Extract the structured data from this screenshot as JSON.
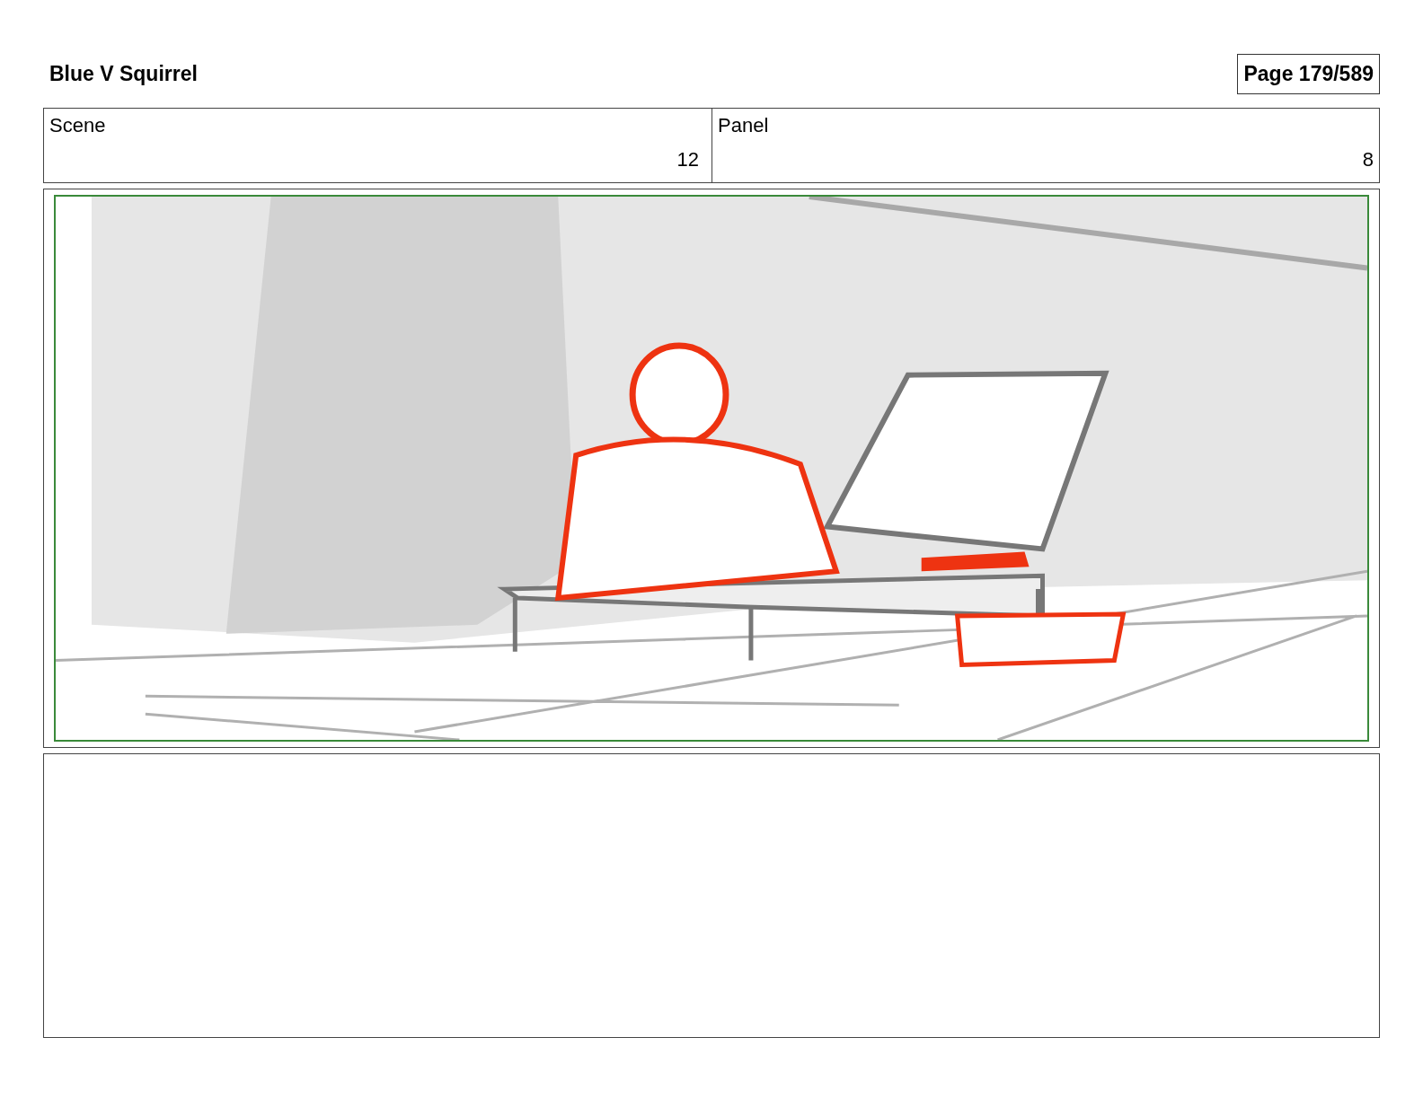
{
  "header": {
    "title": "Blue V Squirrel",
    "page": "Page 179/589"
  },
  "fields": [
    {
      "label": "Scene",
      "value": "12"
    },
    {
      "label": "Panel",
      "value": "8"
    }
  ]
}
